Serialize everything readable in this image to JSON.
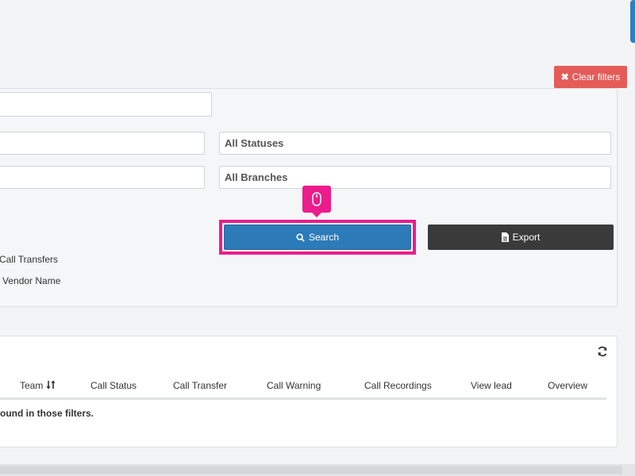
{
  "buttons": {
    "clear_filters": "Clear filters",
    "search": "Search",
    "export": "Export"
  },
  "filters": {
    "status_select": "All Statuses",
    "branch_select": "All Branches",
    "options": [
      "Call Transfers",
      "Vendor Name"
    ]
  },
  "results": {
    "columns": [
      "Team",
      "Call Status",
      "Call Transfer",
      "Call Warning",
      "Call Recordings",
      "View lead",
      "Overview"
    ],
    "empty_message": "ound in those filters."
  },
  "colors": {
    "accent_blue": "#2c7bb8",
    "danger_red": "#e45b58",
    "highlight_pink": "#ec1c8c",
    "dark_button": "#3a3a3a"
  },
  "icons": {
    "clear_filters": "times-icon",
    "search": "magnifier-icon",
    "export": "file-icon",
    "refresh": "refresh-icon",
    "cursor": "mouse-icon",
    "team_sort": "sort-icon"
  }
}
